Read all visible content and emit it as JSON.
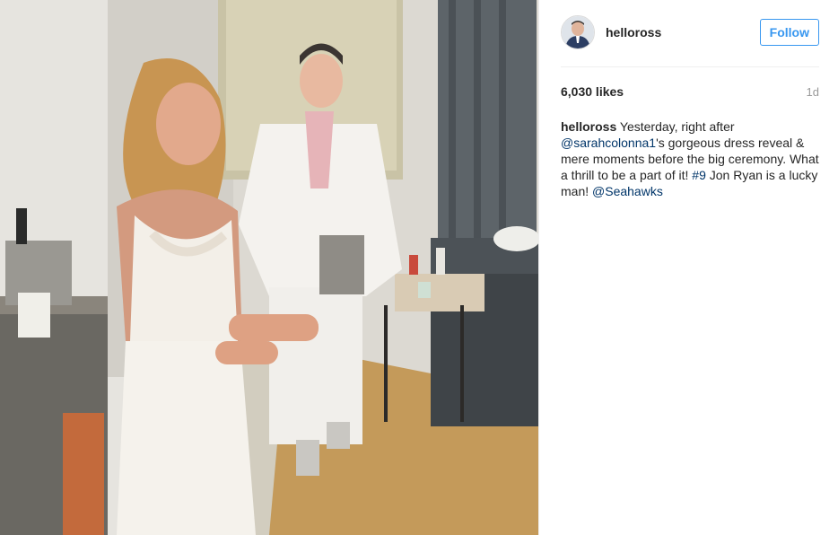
{
  "post": {
    "username": "helloross",
    "follow_label": "Follow",
    "likes": "6,030 likes",
    "age": "1d",
    "caption": {
      "user": "helloross",
      "text_1": " Yesterday, right after ",
      "mention_1": "@sarahcolonna1",
      "text_2": "'s gorgeous dress reveal & mere moments before the big ceremony. What a thrill to be a part of it! ",
      "hashtag": "#9",
      "text_3": " Jon Ryan is a lucky man! ",
      "mention_2": "@Seahawks"
    }
  },
  "colors": {
    "follow_blue": "#3897f0",
    "link_blue": "#003569",
    "meta_gray": "#999999"
  }
}
